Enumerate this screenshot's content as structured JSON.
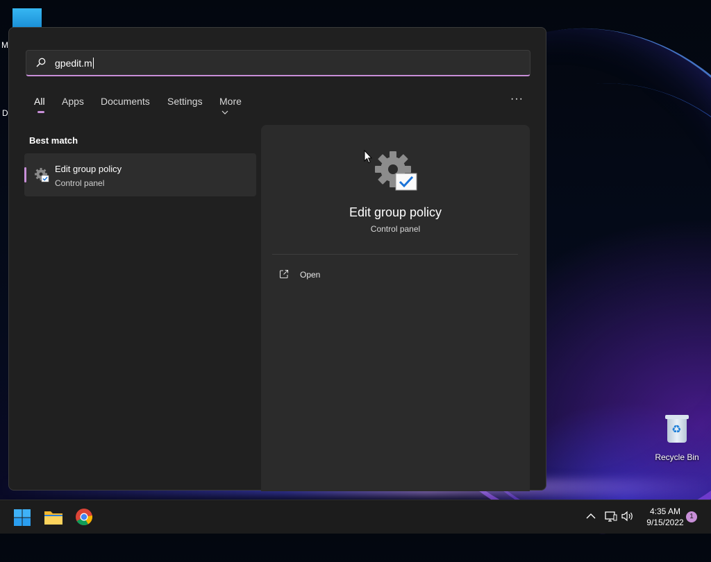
{
  "desktop": {
    "fragments": [
      "M",
      "Da"
    ],
    "recycle_bin_label": "Recycle Bin"
  },
  "search": {
    "query": "gpedit.m"
  },
  "tabs": [
    {
      "label": "All",
      "active": true
    },
    {
      "label": "Apps",
      "active": false
    },
    {
      "label": "Documents",
      "active": false
    },
    {
      "label": "Settings",
      "active": false
    },
    {
      "label": "More",
      "active": false
    }
  ],
  "more_chevron": "⌵",
  "overflow_menu": "···",
  "best_match": {
    "heading": "Best match",
    "item": {
      "title": "Edit group policy",
      "subtitle": "Control panel",
      "icon": "gear-check-icon"
    }
  },
  "detail": {
    "title": "Edit group policy",
    "subtitle": "Control panel",
    "actions": [
      {
        "label": "Open",
        "icon": "open-external-icon"
      }
    ]
  },
  "taskbar": {
    "items": [
      "windows-start-icon",
      "file-explorer-icon",
      "chrome-icon"
    ],
    "tray_icons": [
      "chevron-up-icon",
      "network-icon",
      "volume-icon"
    ],
    "time": "4:35 AM",
    "date": "9/15/2022",
    "notification_count": "1"
  },
  "colors": {
    "accent": "#c88fd8",
    "panel": "#202020",
    "detail": "#2b2b2b"
  }
}
